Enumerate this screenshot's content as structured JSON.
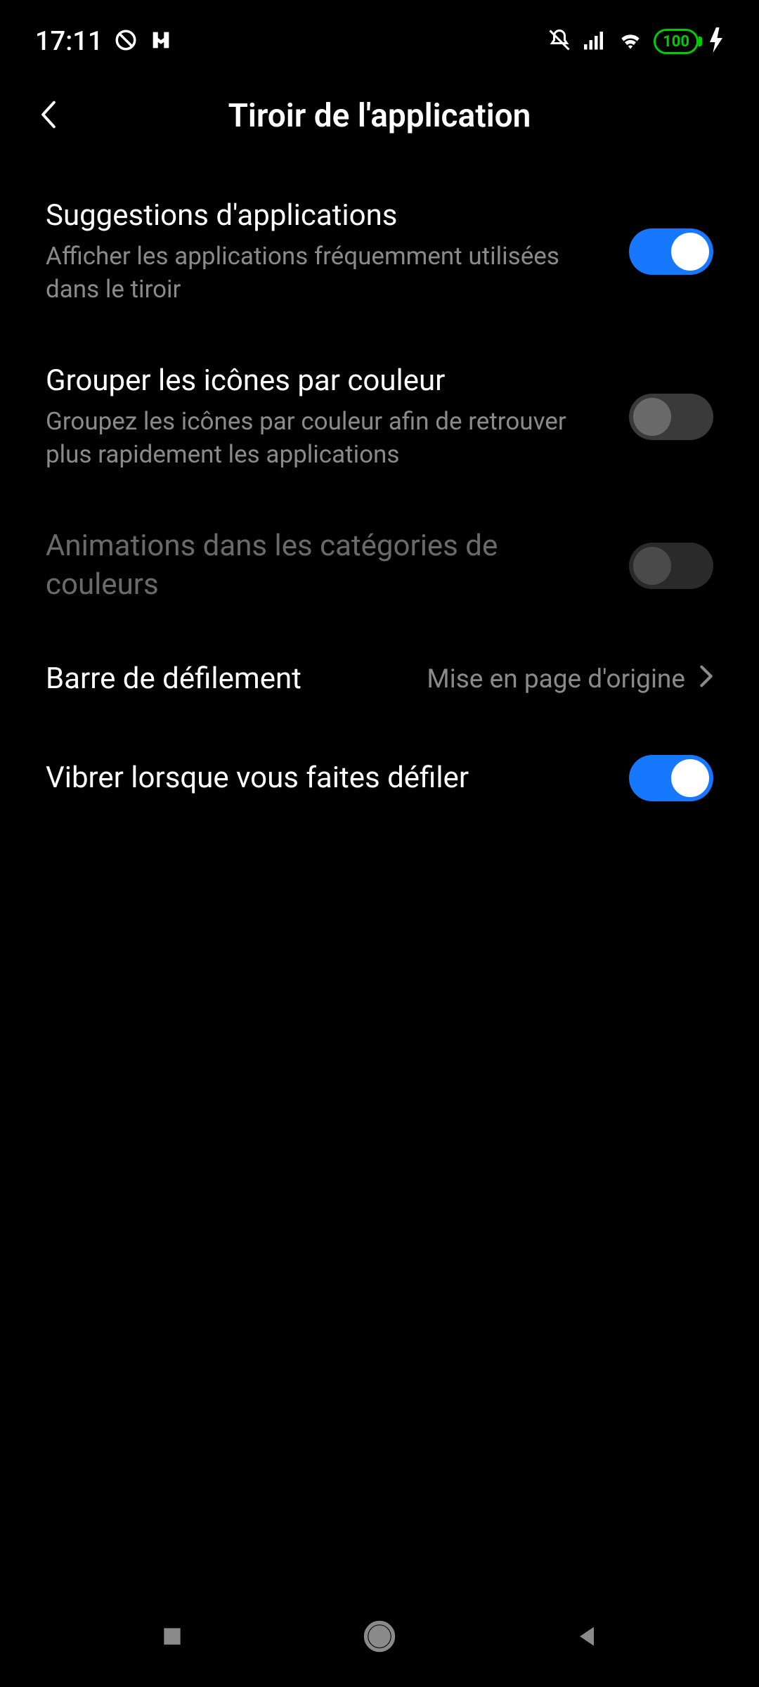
{
  "statusbar": {
    "time": "17:11",
    "battery": "100"
  },
  "header": {
    "title": "Tiroir de l'application"
  },
  "settings": {
    "suggestions": {
      "title": "Suggestions d'applications",
      "subtitle": "Afficher les applications fréquemment utilisées dans le tiroir",
      "enabled": true
    },
    "group_by_color": {
      "title": "Grouper les icônes par couleur",
      "subtitle": "Groupez les icônes par couleur afin de retrouver plus rapidement les applications",
      "enabled": false
    },
    "animations": {
      "title": "Animations dans les catégories de couleurs",
      "enabled": false,
      "disabled_state": true
    },
    "scrollbar": {
      "title": "Barre de défilement",
      "value": "Mise en page d'origine"
    },
    "vibrate": {
      "title": "Vibrer lorsque vous faites défiler",
      "enabled": true
    }
  }
}
